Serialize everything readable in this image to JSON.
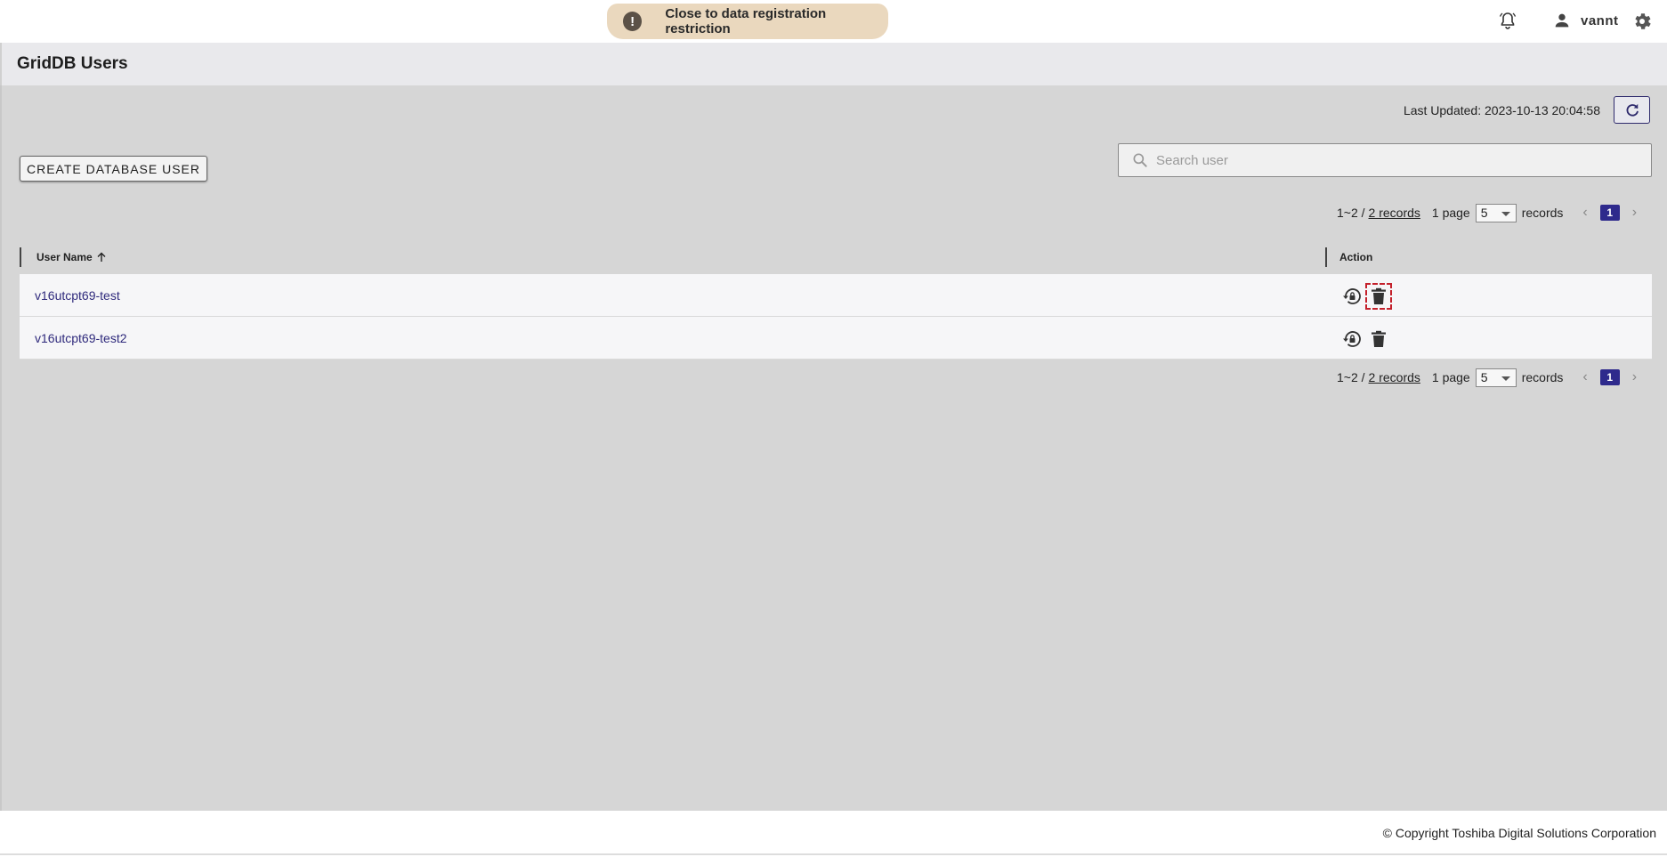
{
  "topbar": {
    "warning_text": "Close to data registration restriction",
    "warning_symbol": "!",
    "user_name": "vannt"
  },
  "header": {
    "title": "GridDB Users"
  },
  "main": {
    "last_updated": "Last Updated: 2023-10-13 20:04:58",
    "create_button_label": "CREATE DATABASE USER",
    "search_placeholder": "Search user",
    "pagination": {
      "range": "1~2 /",
      "records_link": "2 records",
      "page_label": "1 page",
      "page_size": "5",
      "records_label": "records",
      "current_page": "1",
      "prev_symbol": "‹",
      "next_symbol": "›"
    },
    "table": {
      "columns": [
        "User Name",
        "Action"
      ],
      "rows": [
        {
          "username": "v16utcpt69-test"
        },
        {
          "username": "v16utcpt69-test2"
        }
      ]
    }
  },
  "footer": {
    "copyright": "© Copyright Toshiba Digital Solutions Corporation"
  },
  "colors": {
    "accent": "#2e2a8c",
    "warning_bg": "#ead8be",
    "main_bg": "#d6d6d6",
    "focus_outline": "#c4202b"
  },
  "icons": [
    "warning-icon",
    "bell-icon",
    "user-icon",
    "gear-icon",
    "refresh-icon",
    "search-icon",
    "sort-up-icon",
    "lock-reset-icon",
    "trash-icon"
  ]
}
